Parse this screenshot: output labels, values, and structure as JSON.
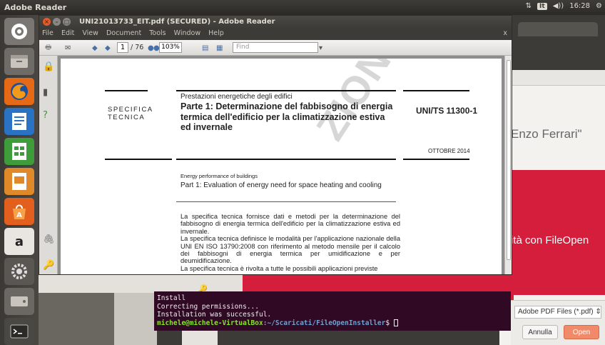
{
  "top_panel": {
    "title": "Adobe Reader",
    "keyboard": "It",
    "volume": "◀))",
    "clock": "16:28"
  },
  "reader": {
    "window_title": "UNI21013733_EIT.pdf (SECURED) - Adobe Reader",
    "menu": [
      "File",
      "Edit",
      "View",
      "Document",
      "Tools",
      "Window",
      "Help"
    ],
    "menu_close": "x",
    "page_current": "1",
    "page_total": "/ 76",
    "zoom": "103%",
    "find_placeholder": "Find"
  },
  "document": {
    "watermark": "ZIONE",
    "label_spec": "SPECIFICA TECNICA",
    "title_small": "Prestazioni energetiche degli edifici",
    "title_main": "Parte 1: Determinazione del fabbisogno di energia termica dell'edificio per la climatizzazione estiva ed invernale",
    "standard_code": "UNI/TS 11300-1",
    "date": "OTTOBRE 2014",
    "en_small": "Energy performance of buildings",
    "en_title": "Part 1: Evaluation of energy need for space heating and cooling",
    "body_p1": "La specifica tecnica fornisce dati e metodi per la determinazione del fabbisogno di energia termica dell'edificio per la climatizzazione estiva ed invernale.",
    "body_p2": "La specifica tecnica definisce le modalità per l'applicazione nazionale della UNI EN ISO 13790:2008 con riferimento al metodo mensile per il calcolo dei fabbisogni di energia termica per umidificazione e per deumidificazione.",
    "body_p3": "La specifica tecnica è rivolta a tutte le possibili applicazioni previste"
  },
  "background_app": {
    "ferrari_text": "Enzo Ferrari\"",
    "fileopen_text": "ità con FileOpen"
  },
  "terminal": {
    "line1": "Install",
    "line2": "Correcting permissions...",
    "line3": "Installation was successful.",
    "prompt_user": "michele@michele-VirtualBox",
    "prompt_path": ":~/Scaricati/FileOpenInstaller",
    "prompt_symbol": "$"
  },
  "file_dialog": {
    "filter": "Adobe PDF Files (*.pdf)",
    "cancel": "Annulla",
    "open": "Open"
  },
  "colors": {
    "accent_red": "#d51d3c",
    "terminal_bg": "#300a24",
    "ubuntu_orange": "#dd4814"
  }
}
